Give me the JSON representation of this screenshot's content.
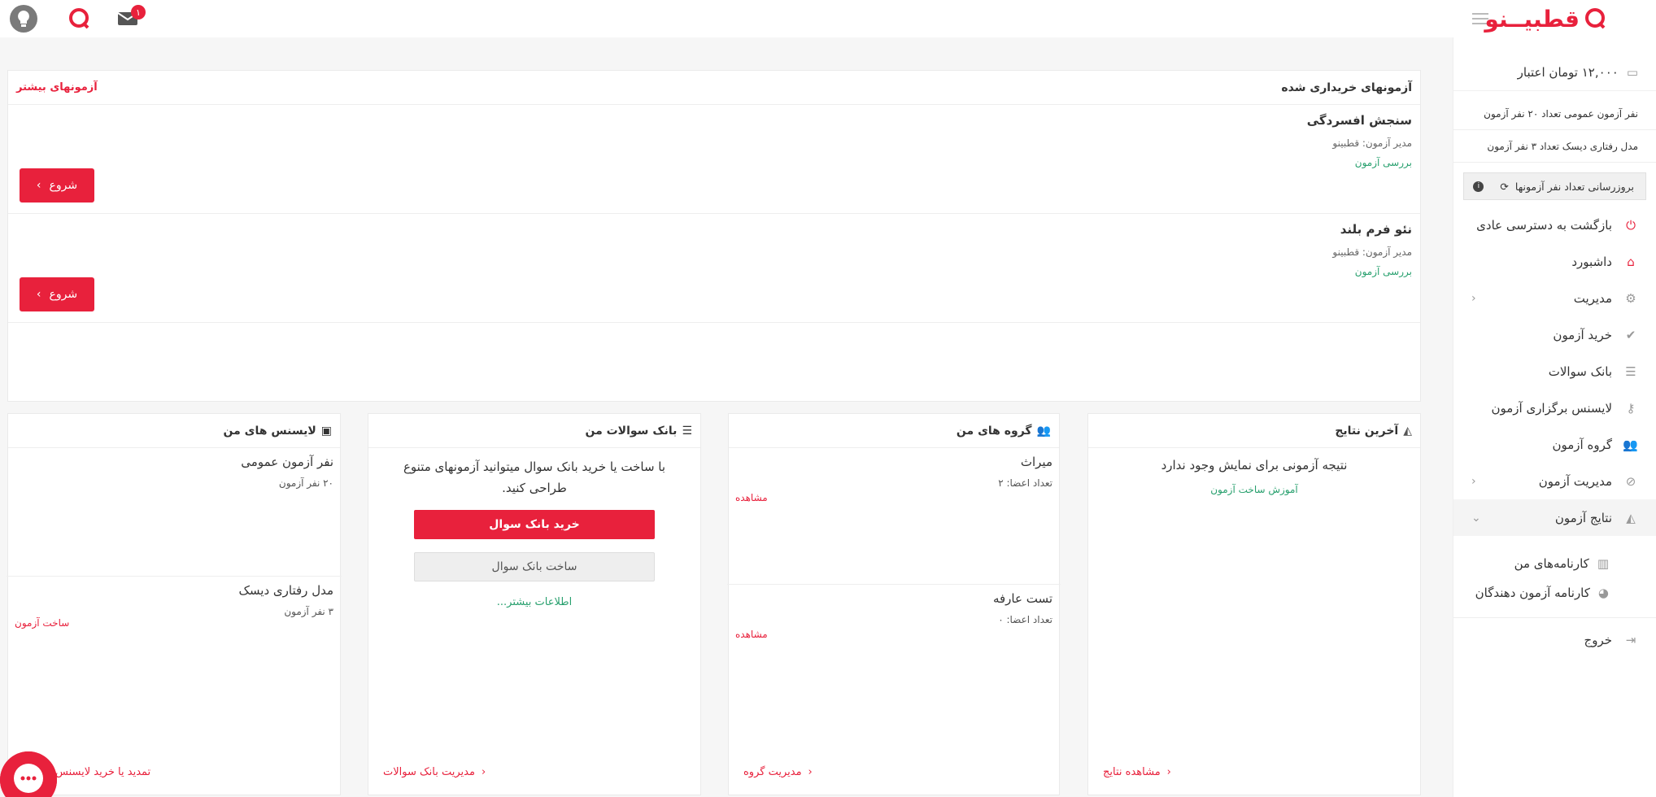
{
  "topbar": {
    "notifications_count": "۱",
    "logo_text": "قطبیــنو"
  },
  "sidebar": {
    "credit": "۱۲,۰۰۰ تومان اعتبار",
    "license_lines": [
      "نفر آزمون عمومی تعداد ۲۰ نفر آزمون",
      "مدل رفتاری دیسک تعداد ۳ نفر آزمون"
    ],
    "update_label": "بروزرسانی تعداد نفر آزمونها",
    "items": [
      {
        "label": "بازگشت به دسترسی عادی"
      },
      {
        "label": "داشبورد"
      },
      {
        "label": "مدیریت"
      },
      {
        "label": "خرید آزمون"
      },
      {
        "label": "بانک سوالات"
      },
      {
        "label": "لایسنس برگزاری آزمون"
      },
      {
        "label": "گروه آزمون"
      },
      {
        "label": "مدیریت آزمون"
      },
      {
        "label": "نتایج آزمون"
      }
    ],
    "subitems": [
      {
        "label": "کارنامه‌های من"
      },
      {
        "label": "کارنامه آزمون دهندگان"
      }
    ],
    "logout": "خروج"
  },
  "purchased": {
    "title": "آزمونهای خریداری شده",
    "more": "آزمونهای بیشتر",
    "exams": [
      {
        "name": "سنجش افسردگی",
        "manager": "مدیر آزمون: قطبینو",
        "review": "بررسی آزمون",
        "start": "شروع"
      },
      {
        "name": "نئو فرم بلند",
        "manager": "مدیر آزمون: قطبینو",
        "review": "بررسی آزمون",
        "start": "شروع"
      }
    ]
  },
  "results": {
    "title": "آخرین نتایج",
    "empty": "نتیجه آزمونی برای نمایش وجود ندارد",
    "tutorial": "آموزش ساخت آزمون",
    "footer": "مشاهده نتایج"
  },
  "groups": {
    "title": "گروه های من",
    "items": [
      {
        "name": "میراث",
        "members": "تعداد اعضا: ۲",
        "view": "مشاهده"
      },
      {
        "name": "تست عارفه",
        "members": "تعداد اعضا: ۰",
        "view": "مشاهده"
      }
    ],
    "footer": "مدیریت گروه"
  },
  "bank": {
    "title": "بانک سوالات من",
    "text": "با ساخت یا خرید بانک سوال میتوانید آزمونهای متنوع طراحی کنید.",
    "buy": "خرید بانک سوال",
    "create": "ساخت بانک سوال",
    "more": "اطلاعات بیشتر...",
    "footer": "مدیریت بانک سوالات"
  },
  "licenses": {
    "title": "لایسنس های من",
    "items": [
      {
        "name": "نفر آزمون عمومی",
        "count": "۲۰ نفر آزمون",
        "action": ""
      },
      {
        "name": "مدل رفتاری دیسک",
        "count": "۳ نفر آزمون",
        "action": "ساخت آزمون"
      }
    ],
    "footer": "تمدید یا خرید لایسنس"
  }
}
